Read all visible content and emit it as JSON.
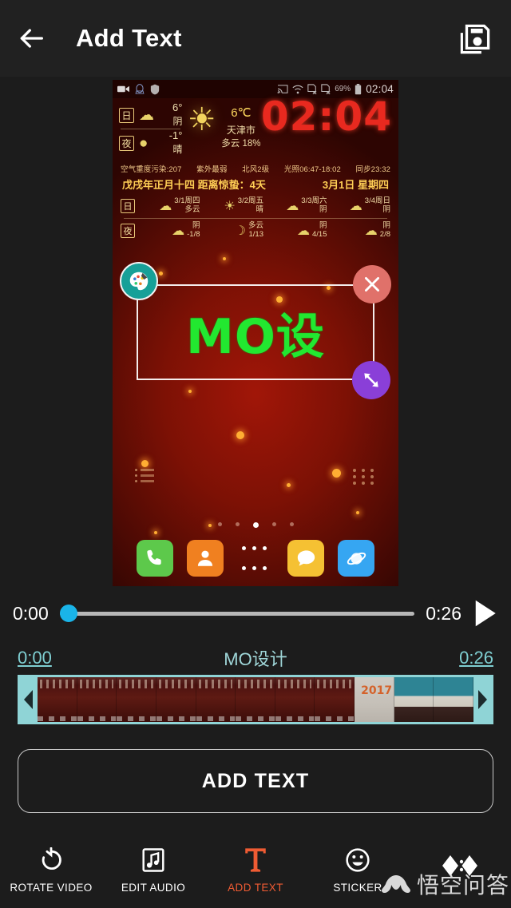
{
  "header": {
    "title": "Add Text",
    "back_icon": "arrow-left-icon",
    "save_icon": "save-icon"
  },
  "preview": {
    "statusbar": {
      "left_icons": [
        "video-camera-icon",
        "qq-penguin-icon",
        "shield-icon"
      ],
      "right_icons": [
        "cast-icon",
        "wifi-icon",
        "sim1-off-icon",
        "sim2-off-icon"
      ],
      "battery_percent": "69%",
      "battery_icon": "battery-icon",
      "clock": "02:04"
    },
    "widget": {
      "day_label": "日",
      "night_label": "夜",
      "day_temp": "6°",
      "day_cond": "阴",
      "night_temp": "-1°",
      "night_cond": "晴",
      "current_temp": "6℃",
      "city": "天津市",
      "humidity": "多云 18%",
      "meta": [
        "空气重度污染:207",
        "紫外最弱",
        "北风2级",
        "光照06:47-18:02",
        "同步23:32"
      ],
      "lunar": "戊戌年正月十四  距离惊蛰：4天",
      "date": "3月1日  星期四",
      "forecast": [
        {
          "date": "3/1周四",
          "day_cond": "多云",
          "night_cond": "阴",
          "temps": "-1/8"
        },
        {
          "date": "3/2周五",
          "day_cond": "晴",
          "night_cond": "多云",
          "temps": "1/13"
        },
        {
          "date": "3/3周六",
          "day_cond": "阴",
          "night_cond": "阴",
          "temps": "4/15"
        },
        {
          "date": "3/4周日",
          "day_cond": "阴",
          "night_cond": "阴",
          "temps": "2/8"
        }
      ]
    },
    "dock": [
      {
        "name": "phone-app-icon",
        "color": "#5dc94b"
      },
      {
        "name": "contacts-app-icon",
        "color": "#f08020"
      },
      {
        "name": "app-drawer-icon",
        "color": "transparent"
      },
      {
        "name": "messages-app-icon",
        "color": "#f5c133"
      },
      {
        "name": "browser-app-icon",
        "color": "#36a6f2"
      }
    ],
    "page_dots": {
      "count": 5,
      "active_index": 2
    }
  },
  "text_overlay": {
    "text": "MO设",
    "text_color": "#22e830",
    "palette_handle_icon": "palette-icon",
    "close_handle_icon": "close-x-icon",
    "resize_handle_icon": "resize-diagonal-icon"
  },
  "playback": {
    "current_time": "0:00",
    "total_time": "0:26",
    "progress_percent": 0,
    "play_icon": "play-icon",
    "thumb_color": "#1ab4e8"
  },
  "timeline": {
    "start_time": "0:00",
    "end_time": "0:26",
    "clip_title": "MO设计",
    "left_handle_icon": "chevron-left-icon",
    "right_handle_icon": "chevron-right-icon",
    "accent_color": "#8fd4d6",
    "frame_year_label": "2017"
  },
  "add_text_button": {
    "label": "ADD TEXT"
  },
  "toolbar": {
    "items": [
      {
        "label": "ROTATE VIDEO",
        "icon": "rotate-icon",
        "active": false
      },
      {
        "label": "EDIT AUDIO",
        "icon": "music-note-icon",
        "active": false
      },
      {
        "label": "ADD TEXT",
        "icon": "text-t-icon",
        "active": true
      },
      {
        "label": "STICKER",
        "icon": "smiley-icon",
        "active": false
      },
      {
        "label": "",
        "icon": "transition-diamonds-icon",
        "active": false
      }
    ],
    "active_color": "#ef5b33"
  },
  "watermark": {
    "text": "悟空问答",
    "icon": "wukong-logo-icon"
  }
}
